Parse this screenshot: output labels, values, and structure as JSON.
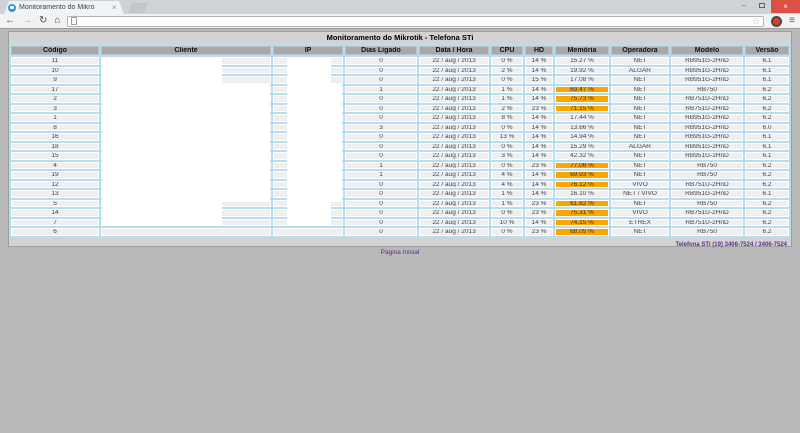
{
  "browser": {
    "tab": {
      "title": "Monitoramento do Mikro",
      "close_glyph": "×"
    },
    "window_controls": {
      "minimize_glyph": "–",
      "close_glyph": "×"
    },
    "toolbar": {
      "back_glyph": "←",
      "forward_glyph": "→",
      "reload_glyph": "↻",
      "home_glyph": "⌂",
      "address_value": "",
      "star_glyph": "☆",
      "menu_glyph": "≡"
    }
  },
  "page": {
    "title": "Monitoramento do Mikrotik - Telefona STi",
    "colors": {
      "alert_orange": "#ffa500",
      "table_blue": "#b5dfee",
      "link_purple": "#5b2d8e"
    },
    "table": {
      "headers": [
        "Código",
        "Cliente",
        "IP",
        "Dias Ligado",
        "Data / Hora",
        "CPU",
        "HD",
        "Memória",
        "Operadora",
        "Modelo",
        "Versão"
      ],
      "rows": [
        {
          "codigo": "11",
          "cliente": "",
          "ip": "",
          "dias": "0",
          "datahora": "22 / aug / 2013",
          "cpu": "0 %",
          "hd": "14 %",
          "mem": "15.27 %",
          "alert": false,
          "oper": "NET",
          "modelo": "RB951G-2HnD",
          "versao": "6.1"
        },
        {
          "codigo": "10",
          "cliente": "",
          "ip": "",
          "dias": "0",
          "datahora": "22 / aug / 2013",
          "cpu": "2 %",
          "hd": "14 %",
          "mem": "19.92 %",
          "alert": false,
          "oper": "ALGAR",
          "modelo": "RB951G-2HnD",
          "versao": "6.1"
        },
        {
          "codigo": "9",
          "cliente": "",
          "ip": "",
          "dias": "0",
          "datahora": "22 / aug / 2013",
          "cpu": "0 %",
          "hd": "15 %",
          "mem": "17.08 %",
          "alert": false,
          "oper": "NET",
          "modelo": "RB951G-2HnD",
          "versao": "6.1"
        },
        {
          "codigo": "17",
          "cliente": "",
          "ip": "",
          "dias": "1",
          "datahora": "22 / aug / 2013",
          "cpu": "1 %",
          "hd": "14 %",
          "mem": "69.47 %",
          "alert": true,
          "oper": "NET",
          "modelo": "RB750",
          "versao": "6.2"
        },
        {
          "codigo": "2",
          "cliente": "",
          "ip": "",
          "dias": "0",
          "datahora": "22 / aug / 2013",
          "cpu": "1 %",
          "hd": "14 %",
          "mem": "75.73 %",
          "alert": true,
          "oper": "NET",
          "modelo": "RB751U-2HnD",
          "versao": "6.2"
        },
        {
          "codigo": "3",
          "cliente": "",
          "ip": "",
          "dias": "0",
          "datahora": "22 / aug / 2013",
          "cpu": "2 %",
          "hd": "23 %",
          "mem": "71.15 %",
          "alert": true,
          "oper": "NET",
          "modelo": "RB751U-2HnD",
          "versao": "6.2"
        },
        {
          "codigo": "1",
          "cliente": "",
          "ip": "",
          "dias": "0",
          "datahora": "22 / aug / 2013",
          "cpu": "8 %",
          "hd": "14 %",
          "mem": "17.44 %",
          "alert": false,
          "oper": "NET",
          "modelo": "RB951G-2HnD",
          "versao": "6.2"
        },
        {
          "codigo": "8",
          "cliente": "",
          "ip": "",
          "dias": "3",
          "datahora": "22 / aug / 2013",
          "cpu": "0 %",
          "hd": "14 %",
          "mem": "13.66 %",
          "alert": false,
          "oper": "NET",
          "modelo": "RB951G-2HnD",
          "versao": "6.0"
        },
        {
          "codigo": "16",
          "cliente": "",
          "ip": "",
          "dias": "0",
          "datahora": "22 / aug / 2013",
          "cpu": "13 %",
          "hd": "14 %",
          "mem": "14.94 %",
          "alert": false,
          "oper": "NET",
          "modelo": "RB951G-2HnD",
          "versao": "6.1"
        },
        {
          "codigo": "18",
          "cliente": "",
          "ip": "",
          "dias": "0",
          "datahora": "22 / aug / 2013",
          "cpu": "0 %",
          "hd": "14 %",
          "mem": "15.29 %",
          "alert": false,
          "oper": "ALGAR",
          "modelo": "RB951G-2HnD",
          "versao": "6.1"
        },
        {
          "codigo": "15",
          "cliente": "",
          "ip": "",
          "dias": "0",
          "datahora": "22 / aug / 2013",
          "cpu": "3 %",
          "hd": "14 %",
          "mem": "42.32 %",
          "alert": false,
          "oper": "NET",
          "modelo": "RB951G-2HnD",
          "versao": "6.1"
        },
        {
          "codigo": "4",
          "cliente": "",
          "ip": "",
          "dias": "1",
          "datahora": "22 / aug / 2013",
          "cpu": "0 %",
          "hd": "23 %",
          "mem": "77.06 %",
          "alert": true,
          "oper": "NET",
          "modelo": "RB750",
          "versao": "6.2"
        },
        {
          "codigo": "19",
          "cliente": "",
          "ip": "",
          "dias": "1",
          "datahora": "22 / aug / 2013",
          "cpu": "4 %",
          "hd": "14 %",
          "mem": "69.93 %",
          "alert": true,
          "oper": "NET",
          "modelo": "RB750",
          "versao": "6.2"
        },
        {
          "codigo": "12",
          "cliente": "",
          "ip": "",
          "dias": "0",
          "datahora": "22 / aug / 2013",
          "cpu": "4 %",
          "hd": "14 %",
          "mem": "76.12 %",
          "alert": true,
          "oper": "VIVO",
          "modelo": "RB751U-2HnD",
          "versao": "6.2"
        },
        {
          "codigo": "13",
          "cliente": "",
          "ip": "",
          "dias": "0",
          "datahora": "22 / aug / 2013",
          "cpu": "1 %",
          "hd": "14 %",
          "mem": "16.10 %",
          "alert": false,
          "oper": "NET / VIVO",
          "modelo": "RB951G-2HnD",
          "versao": "6.1"
        },
        {
          "codigo": "5",
          "cliente": "",
          "ip": "",
          "dias": "0",
          "datahora": "22 / aug / 2013",
          "cpu": "1 %",
          "hd": "23 %",
          "mem": "61.82 %",
          "alert": true,
          "oper": "NET",
          "modelo": "RB750",
          "versao": "6.2"
        },
        {
          "codigo": "14",
          "cliente": "",
          "ip": "",
          "dias": "0",
          "datahora": "22 / aug / 2013",
          "cpu": "0 %",
          "hd": "23 %",
          "mem": "75.31 %",
          "alert": true,
          "oper": "VIVO",
          "modelo": "RB751U-2HnD",
          "versao": "6.2"
        },
        {
          "codigo": "7",
          "cliente": "",
          "ip": "",
          "dias": "0",
          "datahora": "22 / aug / 2013",
          "cpu": "10 %",
          "hd": "14 %",
          "mem": "74.15 %",
          "alert": true,
          "oper": "ETREX",
          "modelo": "RB751U-2HnD",
          "versao": "6.2"
        },
        {
          "codigo": "6",
          "cliente": "",
          "ip": "",
          "dias": "0",
          "datahora": "22 / aug / 2013",
          "cpu": "0 %",
          "hd": "23 %",
          "mem": "68.05 %",
          "alert": true,
          "oper": "NET",
          "modelo": "RB750",
          "versao": "6.2"
        }
      ]
    },
    "footer": {
      "home_link": "Pagina Inicial",
      "phone": "Telefona STi (19) 3406-7524 / 3406-7524"
    }
  }
}
